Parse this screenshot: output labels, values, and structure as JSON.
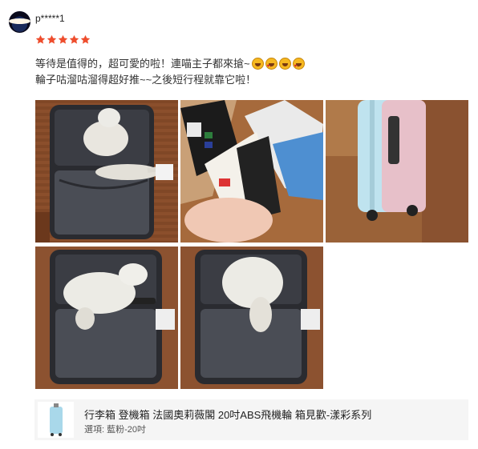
{
  "review": {
    "username": "p*****1",
    "rating": 5,
    "rating_max": 5,
    "comment_lines": [
      "等待是值得的，超可愛的啦！連喵主子都來搶~",
      "輪子咕溜咕溜得超好推~~之後短行程就靠它啦！"
    ],
    "emojis": [
      "grinning-face-icon",
      "star-struck-icon",
      "grinning-face-icon",
      "star-struck-icon"
    ],
    "photos": [
      {
        "name": "cat-in-suitcase-photo"
      },
      {
        "name": "product-tags-photo"
      },
      {
        "name": "suitcase-side-photo"
      },
      {
        "name": "cat-in-suitcase-photo-2"
      },
      {
        "name": "cat-in-suitcase-photo-3"
      }
    ]
  },
  "product": {
    "name": "行李箱 登機箱 法國奧莉薇閣 20吋ABS飛機輪 箱見歡-漾彩系列",
    "variant": "選項: 藍粉-20吋"
  },
  "colors": {
    "star": "#ee4d2d",
    "product_bg": "#f5f5f5",
    "suitcase_blue": "#a9d8ea",
    "suitcase_pink": "#e6b9c3"
  }
}
